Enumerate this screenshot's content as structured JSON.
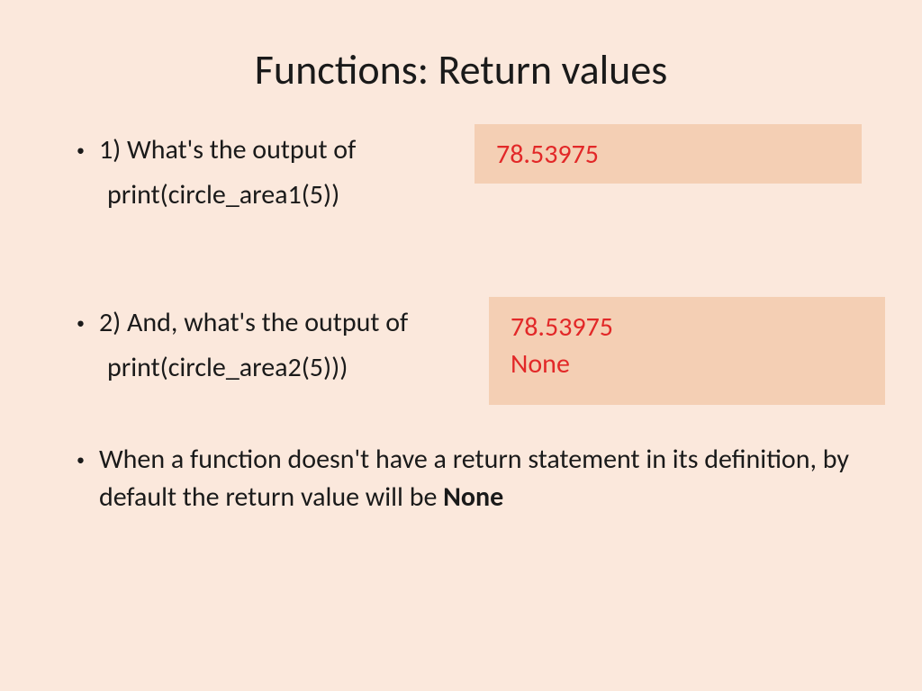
{
  "title": "Functions: Return values",
  "bullets": {
    "q1": {
      "line1": "1) What's the output of",
      "line2": "print(circle_area1(5))"
    },
    "q2": {
      "line1": "2) And, what's the output of",
      "line2": "print(circle_area2(5)))"
    },
    "note": {
      "text_before": "When a function doesn't have a return statement in its definition, by default the return value will be ",
      "bold_word": "None"
    }
  },
  "answers": {
    "a1": "78.53975",
    "a2_line1": "78.53975",
    "a2_line2": "None"
  }
}
